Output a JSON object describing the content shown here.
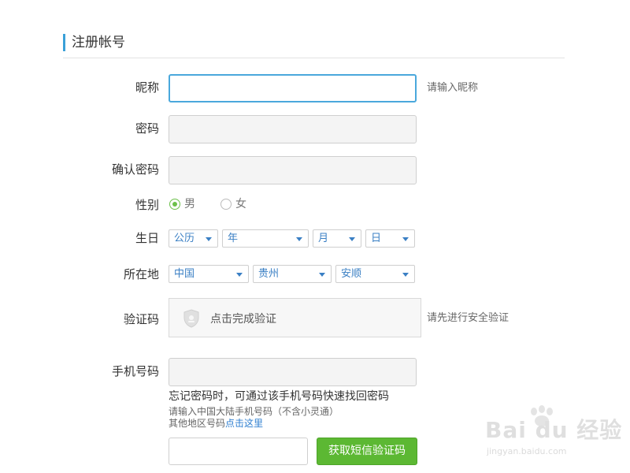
{
  "section": {
    "title": "注册帐号"
  },
  "form": {
    "nickname": {
      "label": "昵称",
      "value": "",
      "hint": "请输入昵称"
    },
    "password": {
      "label": "密码",
      "value": ""
    },
    "confirm_password": {
      "label": "确认密码",
      "value": ""
    },
    "gender": {
      "label": "性别",
      "options": [
        {
          "label": "男",
          "checked": true
        },
        {
          "label": "女",
          "checked": false
        }
      ]
    },
    "birthday": {
      "label": "生日",
      "calendar": "公历",
      "year": "年",
      "month": "月",
      "day": "日"
    },
    "location": {
      "label": "所在地",
      "country": "中国",
      "province": "贵州",
      "city": "安顺"
    },
    "captcha": {
      "label": "验证码",
      "button_text": "点击完成验证",
      "hint": "请先进行安全验证",
      "icon": "shield-icon"
    },
    "phone": {
      "label": "手机号码",
      "value": "",
      "recover_note": "忘记密码时，可通过该手机号码快速找回密码",
      "mainland_note": "请输入中国大陆手机号码（不含小灵通）",
      "other_region_prefix": "其他地区号码",
      "other_region_link": "点击这里"
    },
    "sms": {
      "code_value": "",
      "button_label": "获取短信验证码"
    }
  },
  "watermark": {
    "brand": "Bai du 经验",
    "url": "jingyan.baidu.com"
  },
  "colors": {
    "accent": "#3aa0d8",
    "success": "#5cb833",
    "link": "#2f7fd0"
  }
}
